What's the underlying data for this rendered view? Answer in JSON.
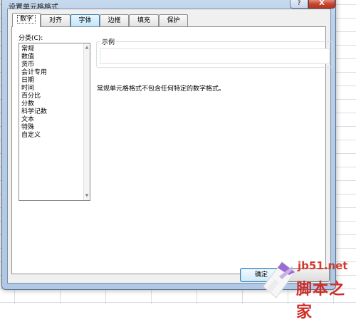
{
  "window": {
    "title": "设置单元格格式",
    "help_glyph": "?",
    "close_glyph": "X"
  },
  "tabs": [
    {
      "label": "数字",
      "selected": true
    },
    {
      "label": "对齐"
    },
    {
      "label": "字体",
      "hover": true
    },
    {
      "label": "边框"
    },
    {
      "label": "填充"
    },
    {
      "label": "保护"
    }
  ],
  "category": {
    "label": "分类(C):",
    "items": [
      "常规",
      "数值",
      "货币",
      "会计专用",
      "日期",
      "时间",
      "百分比",
      "分数",
      "科学记数",
      "文本",
      "特殊",
      "自定义"
    ]
  },
  "sample": {
    "label": "示例",
    "value": ""
  },
  "description": "常规单元格格式不包含任何特定的数字格式。",
  "buttons": {
    "ok_label": "确定"
  },
  "watermark": {
    "url": "jb51.net",
    "name": "脚本之家"
  },
  "colors": {
    "watermark_red": "#cf2d28",
    "selected_tab_border": "#3c7fb1",
    "dialog_frame": "#aec8e6"
  },
  "icons": {
    "scroll_up": "up-arrow-icon",
    "scroll_down": "down-arrow-icon"
  }
}
